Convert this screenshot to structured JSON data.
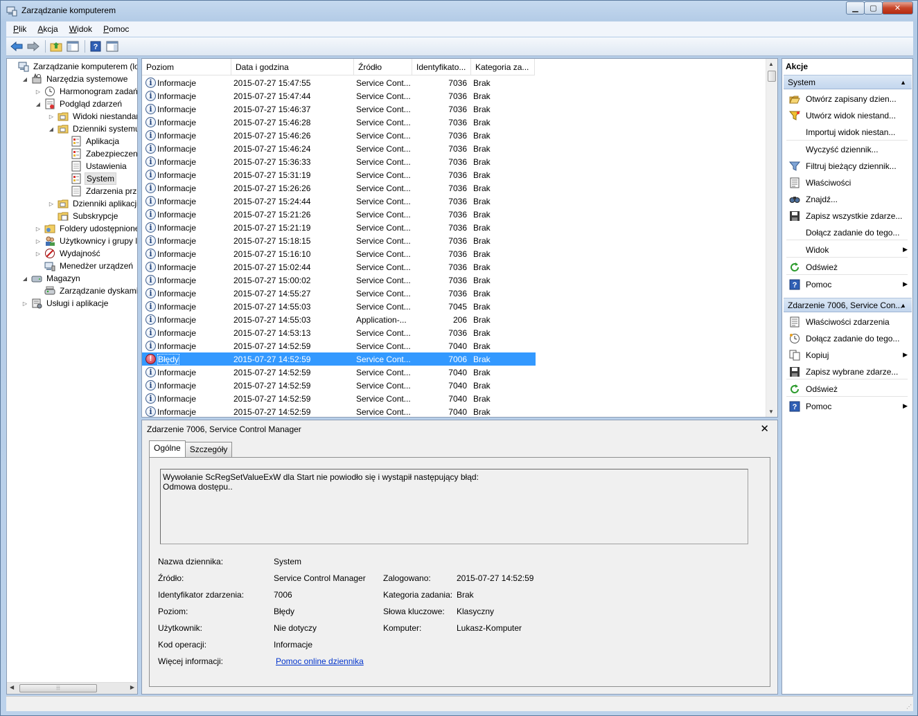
{
  "window": {
    "title": "Zarządzanie komputerem"
  },
  "menu": [
    {
      "key": "P",
      "rest": "lik"
    },
    {
      "key": "A",
      "rest": "kcja"
    },
    {
      "key": "W",
      "rest": "idok"
    },
    {
      "key": "P",
      "rest": "omoc"
    }
  ],
  "toolbar": [
    "back-icon",
    "forward-icon",
    "up-folder-icon",
    "show-hide-tree-icon",
    "help-icon",
    "show-hide-action-pane-icon"
  ],
  "tree": [
    {
      "label": "Zarządzanie komputerem (lokalne)",
      "indent": 0,
      "arrow": "",
      "icon": "computer-management-icon"
    },
    {
      "label": "Narzędzia systemowe",
      "indent": 1,
      "arrow": "◢",
      "icon": "system-tools-icon"
    },
    {
      "label": "Harmonogram zadań",
      "indent": 2,
      "arrow": "▷",
      "icon": "clock-icon"
    },
    {
      "label": "Podgląd zdarzeń",
      "indent": 2,
      "arrow": "◢",
      "icon": "event-viewer-icon"
    },
    {
      "label": "Widoki niestandardowe",
      "indent": 3,
      "arrow": "▷",
      "icon": "folder-icon"
    },
    {
      "label": "Dzienniki systemu Windows",
      "indent": 3,
      "arrow": "◢",
      "icon": "folder-icon"
    },
    {
      "label": "Aplikacja",
      "indent": 4,
      "arrow": "",
      "icon": "log-icon"
    },
    {
      "label": "Zabezpieczenia",
      "indent": 4,
      "arrow": "",
      "icon": "log-icon"
    },
    {
      "label": "Ustawienia",
      "indent": 4,
      "arrow": "",
      "icon": "log-blank-icon"
    },
    {
      "label": "System",
      "indent": 4,
      "arrow": "",
      "icon": "log-icon",
      "selected": true
    },
    {
      "label": "Zdarzenia przesyłane dalej",
      "indent": 4,
      "arrow": "",
      "icon": "log-blank-icon"
    },
    {
      "label": "Dzienniki aplikacji i usług",
      "indent": 3,
      "arrow": "▷",
      "icon": "folder-icon"
    },
    {
      "label": "Subskrypcje",
      "indent": 3,
      "arrow": "",
      "icon": "subscription-icon"
    },
    {
      "label": "Foldery udostępnione",
      "indent": 2,
      "arrow": "▷",
      "icon": "shared-folder-icon"
    },
    {
      "label": "Użytkownicy i grupy lokalne",
      "indent": 2,
      "arrow": "▷",
      "icon": "users-icon"
    },
    {
      "label": "Wydajność",
      "indent": 2,
      "arrow": "▷",
      "icon": "performance-icon"
    },
    {
      "label": "Menedżer urządzeń",
      "indent": 2,
      "arrow": "",
      "icon": "device-manager-icon"
    },
    {
      "label": "Magazyn",
      "indent": 1,
      "arrow": "◢",
      "icon": "storage-icon"
    },
    {
      "label": "Zarządzanie dyskami",
      "indent": 2,
      "arrow": "",
      "icon": "disk-icon"
    },
    {
      "label": "Usługi i aplikacje",
      "indent": 1,
      "arrow": "▷",
      "icon": "services-icon"
    }
  ],
  "events": {
    "headers": [
      "Poziom",
      "Data i godzina",
      "Źródło",
      "Identyfikato...",
      "Kategoria za..."
    ],
    "rows": [
      [
        "Informacje",
        "2015-07-27 15:47:55",
        "Service Cont...",
        "7036",
        "Brak"
      ],
      [
        "Informacje",
        "2015-07-27 15:47:44",
        "Service Cont...",
        "7036",
        "Brak"
      ],
      [
        "Informacje",
        "2015-07-27 15:46:37",
        "Service Cont...",
        "7036",
        "Brak"
      ],
      [
        "Informacje",
        "2015-07-27 15:46:28",
        "Service Cont...",
        "7036",
        "Brak"
      ],
      [
        "Informacje",
        "2015-07-27 15:46:26",
        "Service Cont...",
        "7036",
        "Brak"
      ],
      [
        "Informacje",
        "2015-07-27 15:46:24",
        "Service Cont...",
        "7036",
        "Brak"
      ],
      [
        "Informacje",
        "2015-07-27 15:36:33",
        "Service Cont...",
        "7036",
        "Brak"
      ],
      [
        "Informacje",
        "2015-07-27 15:31:19",
        "Service Cont...",
        "7036",
        "Brak"
      ],
      [
        "Informacje",
        "2015-07-27 15:26:26",
        "Service Cont...",
        "7036",
        "Brak"
      ],
      [
        "Informacje",
        "2015-07-27 15:24:44",
        "Service Cont...",
        "7036",
        "Brak"
      ],
      [
        "Informacje",
        "2015-07-27 15:21:26",
        "Service Cont...",
        "7036",
        "Brak"
      ],
      [
        "Informacje",
        "2015-07-27 15:21:19",
        "Service Cont...",
        "7036",
        "Brak"
      ],
      [
        "Informacje",
        "2015-07-27 15:18:15",
        "Service Cont...",
        "7036",
        "Brak"
      ],
      [
        "Informacje",
        "2015-07-27 15:16:10",
        "Service Cont...",
        "7036",
        "Brak"
      ],
      [
        "Informacje",
        "2015-07-27 15:02:44",
        "Service Cont...",
        "7036",
        "Brak"
      ],
      [
        "Informacje",
        "2015-07-27 15:00:02",
        "Service Cont...",
        "7036",
        "Brak"
      ],
      [
        "Informacje",
        "2015-07-27 14:55:27",
        "Service Cont...",
        "7036",
        "Brak"
      ],
      [
        "Informacje",
        "2015-07-27 14:55:03",
        "Service Cont...",
        "7045",
        "Brak"
      ],
      [
        "Informacje",
        "2015-07-27 14:55:03",
        "Application-...",
        "206",
        "Brak"
      ],
      [
        "Informacje",
        "2015-07-27 14:53:13",
        "Service Cont...",
        "7036",
        "Brak"
      ],
      [
        "Informacje",
        "2015-07-27 14:52:59",
        "Service Cont...",
        "7040",
        "Brak"
      ],
      [
        "Błędy",
        "2015-07-27 14:52:59",
        "Service Cont...",
        "7006",
        "Brak"
      ],
      [
        "Informacje",
        "2015-07-27 14:52:59",
        "Service Cont...",
        "7040",
        "Brak"
      ],
      [
        "Informacje",
        "2015-07-27 14:52:59",
        "Service Cont...",
        "7040",
        "Brak"
      ],
      [
        "Informacje",
        "2015-07-27 14:52:59",
        "Service Cont...",
        "7040",
        "Brak"
      ],
      [
        "Informacje",
        "2015-07-27 14:52:59",
        "Service Cont...",
        "7040",
        "Brak"
      ]
    ],
    "selected_index": 21
  },
  "detail": {
    "title": "Zdarzenie 7006, Service Control Manager",
    "tabs": [
      "Ogólne",
      "Szczegóły"
    ],
    "description_line1": "Wywołanie ScRegSetValueExW dla Start nie powiodło się i wystąpił następujący błąd:",
    "description_line2": "Odmowa dostępu..",
    "fields": {
      "log_name_label": "Nazwa dziennika:",
      "log_name": "System",
      "source_label": "Źródło:",
      "source": "Service Control Manager",
      "logged_label": "Zalogowano:",
      "logged": "2015-07-27 14:52:59",
      "event_id_label": "Identyfikator zdarzenia:",
      "event_id": "7006",
      "task_category_label": "Kategoria zadania:",
      "task_category": "Brak",
      "level_label": "Poziom:",
      "level": "Błędy",
      "keywords_label": "Słowa kluczowe:",
      "keywords": "Klasyczny",
      "user_label": "Użytkownik:",
      "user": "Nie dotyczy",
      "computer_label": "Komputer:",
      "computer": "Lukasz-Komputer",
      "opcode_label": "Kod operacji:",
      "opcode": "Informacje",
      "more_info_label": "Więcej informacji:",
      "more_info_link": "Pomoc online dziennika"
    }
  },
  "actions": {
    "title": "Akcje",
    "section1": "System",
    "section1_items": [
      {
        "label": "Otwórz zapisany dzien...",
        "icon": "open-folder-icon"
      },
      {
        "label": "Utwórz widok niestand...",
        "icon": "filter-create-icon"
      },
      {
        "label": "Importuj widok niestan...",
        "icon": ""
      },
      {
        "label": "Wyczyść dziennik...",
        "icon": ""
      },
      {
        "label": "Filtruj bieżący dziennik...",
        "icon": "filter-icon"
      },
      {
        "label": "Właściwości",
        "icon": "properties-icon"
      },
      {
        "label": "Znajdź...",
        "icon": "find-icon"
      },
      {
        "label": "Zapisz wszystkie zdarze...",
        "icon": "save-icon"
      },
      {
        "label": "Dołącz zadanie do tego...",
        "icon": ""
      },
      {
        "label": "Widok",
        "icon": "",
        "submenu": true
      },
      {
        "label": "Odśwież",
        "icon": "refresh-icon"
      },
      {
        "label": "Pomoc",
        "icon": "help-icon",
        "submenu": true
      }
    ],
    "section2": "Zdarzenie 7006, Service Con...",
    "section2_items": [
      {
        "label": "Właściwości zdarzenia",
        "icon": "properties-icon"
      },
      {
        "label": "Dołącz zadanie do tego...",
        "icon": "task-icon"
      },
      {
        "label": "Kopiuj",
        "icon": "copy-icon",
        "submenu": true
      },
      {
        "label": "Zapisz wybrane zdarze...",
        "icon": "save-icon"
      },
      {
        "label": "Odśwież",
        "icon": "refresh-icon"
      },
      {
        "label": "Pomoc",
        "icon": "help-icon",
        "submenu": true
      }
    ]
  }
}
